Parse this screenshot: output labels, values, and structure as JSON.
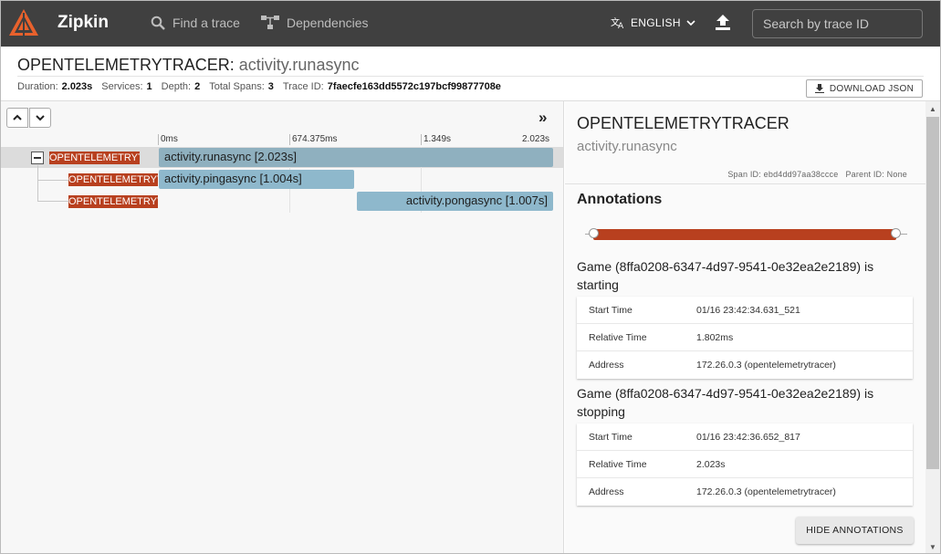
{
  "app": {
    "brand": "Zipkin",
    "nav": {
      "find_trace": "Find a trace",
      "dependencies": "Dependencies"
    },
    "language": "ENGLISH",
    "search_placeholder": "Search by trace ID",
    "colors": {
      "topbar": "#404040",
      "accent": "#b8401f",
      "span_bar": "#8eb4c6"
    }
  },
  "trace": {
    "service": "OPENTELEMETRYTRACER",
    "separator": ":",
    "span_name": "activity.runasync",
    "meta": {
      "duration_label": "Duration:",
      "duration": "2.023s",
      "services_label": "Services:",
      "services": "1",
      "depth_label": "Depth:",
      "depth": "2",
      "total_spans_label": "Total Spans:",
      "total_spans": "3",
      "trace_id_label": "Trace ID:",
      "trace_id": "7faecfe163dd5572c197bcf99877708e"
    },
    "download_label": "DOWNLOAD JSON"
  },
  "timeline": {
    "ticks": [
      "0ms",
      "674.375ms",
      "1.349s",
      "2.023s"
    ],
    "spans": [
      {
        "service": "OPENTELEMETRYTRACER",
        "label": "activity.runasync [2.023s]"
      },
      {
        "service": "OPENTELEMETRYTRACER",
        "label": "activity.pingasync [1.004s]"
      },
      {
        "service": "OPENTELEMETRYTRACER",
        "label": "activity.pongasync [1.007s]"
      }
    ]
  },
  "details": {
    "service": "OPENTELEMETRYTRACER",
    "span_name": "activity.runasync",
    "span_id_label": "Span ID:",
    "span_id": "ebd4dd97aa38ccce",
    "parent_id_label": "Parent ID:",
    "parent_id": "None",
    "annotations_title": "Annotations",
    "annotations": [
      {
        "title": "Game (8ffa0208-6347-4d97-9541-0e32ea2e2189) is starting",
        "rows": [
          {
            "k": "Start Time",
            "v": "01/16 23:42:34.631_521"
          },
          {
            "k": "Relative Time",
            "v": "1.802ms"
          },
          {
            "k": "Address",
            "v": "172.26.0.3 (opentelemetrytracer)"
          }
        ]
      },
      {
        "title": "Game (8ffa0208-6347-4d97-9541-0e32ea2e2189) is stopping",
        "rows": [
          {
            "k": "Start Time",
            "v": "01/16 23:42:36.652_817"
          },
          {
            "k": "Relative Time",
            "v": "2.023s"
          },
          {
            "k": "Address",
            "v": "172.26.0.3 (opentelemetrytracer)"
          }
        ]
      }
    ],
    "hide_label": "HIDE ANNOTATIONS"
  }
}
